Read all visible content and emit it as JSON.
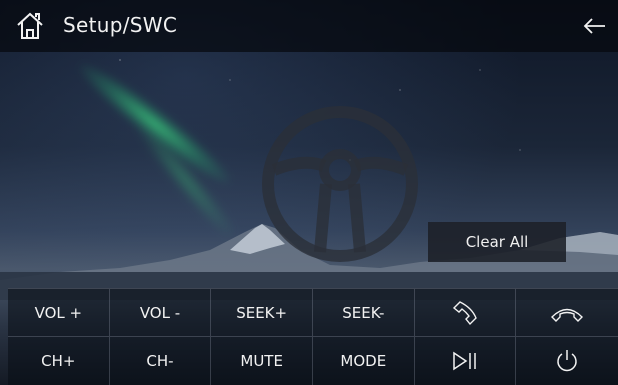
{
  "header": {
    "title": "Setup/SWC"
  },
  "icons": {
    "home": "home-icon",
    "back": "back-arrow-icon",
    "wheel": "steering-wheel-icon",
    "phone_answer": "phone-answer-icon",
    "phone_hangup": "phone-hangup-icon",
    "play_pause": "play-pause-icon",
    "power": "power-icon"
  },
  "clear_all_label": "Clear All",
  "buttons": {
    "row1": [
      "VOL +",
      "VOL -",
      "SEEK+",
      "SEEK-"
    ],
    "row2": [
      "CH+",
      "CH-",
      "MUTE",
      "MODE"
    ]
  },
  "colors": {
    "text": "#f2f2f2",
    "header_bg": "#05080e",
    "aurora": "#3cdc82"
  }
}
